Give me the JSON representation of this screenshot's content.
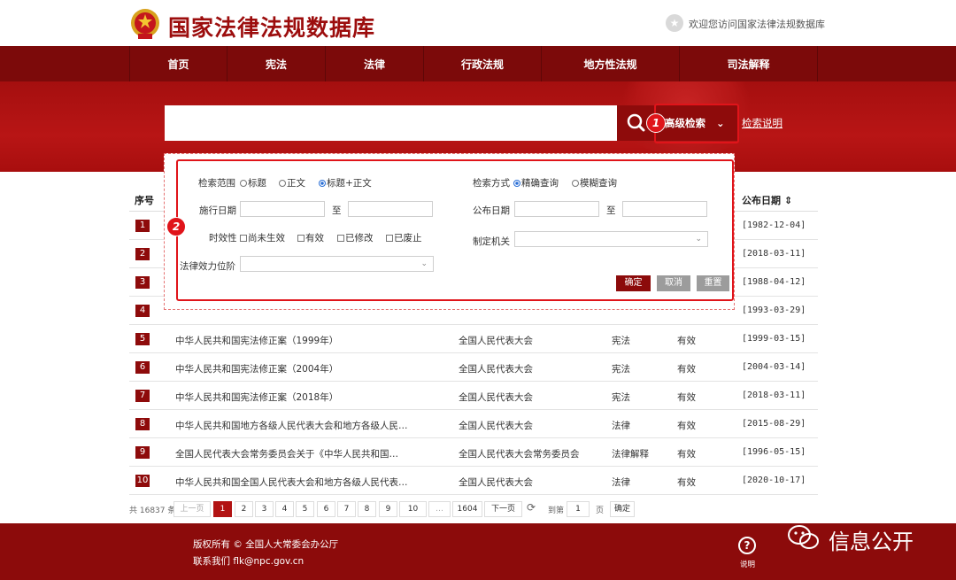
{
  "header": {
    "site_title": "国家法律法规数据库",
    "welcome": "欢迎您访问国家法律法规数据库"
  },
  "nav": [
    "首页",
    "宪法",
    "法律",
    "行政法规",
    "地方性法规",
    "司法解释"
  ],
  "search": {
    "placeholder": "",
    "advanced_label": "高级检索",
    "help_link": "检索说明"
  },
  "callouts": {
    "one": "1",
    "two": "2"
  },
  "advanced_panel": {
    "scope_label": "检索范围",
    "scope_options": [
      {
        "label": "标题",
        "selected": false
      },
      {
        "label": "正文",
        "selected": false
      },
      {
        "label": "标题+正文",
        "selected": true
      }
    ],
    "method_label": "检索方式",
    "method_options": [
      {
        "label": "精确查询",
        "selected": true
      },
      {
        "label": "模糊查询",
        "selected": false
      }
    ],
    "effective_date_label": "施行日期",
    "publish_date_label": "公布日期",
    "to": "至",
    "validity_label": "时效性",
    "validity_options": [
      "尚未生效",
      "有效",
      "已修改",
      "已废止"
    ],
    "authority_label": "制定机关",
    "level_label": "法律效力位阶",
    "confirm": "确定",
    "cancel": "取消",
    "reset": "重置"
  },
  "table": {
    "col_no": "序号",
    "col_date": "公布日期",
    "sort_icon": "sort-icon",
    "rows": [
      {
        "no": "1",
        "title": "",
        "org": "",
        "type": "",
        "status": "",
        "date": "[1982-12-04]"
      },
      {
        "no": "2",
        "title": "",
        "org": "",
        "type": "",
        "status": "",
        "date": "[2018-03-11]"
      },
      {
        "no": "3",
        "title": "",
        "org": "",
        "type": "",
        "status": "",
        "date": "[1988-04-12]"
      },
      {
        "no": "4",
        "title": "",
        "org": "",
        "type": "",
        "status": "",
        "date": "[1993-03-29]"
      },
      {
        "no": "5",
        "title": "中华人民共和国宪法修正案（1999年）",
        "org": "全国人民代表大会",
        "type": "宪法",
        "status": "有效",
        "date": "[1999-03-15]"
      },
      {
        "no": "6",
        "title": "中华人民共和国宪法修正案（2004年）",
        "org": "全国人民代表大会",
        "type": "宪法",
        "status": "有效",
        "date": "[2004-03-14]"
      },
      {
        "no": "7",
        "title": "中华人民共和国宪法修正案（2018年）",
        "org": "全国人民代表大会",
        "type": "宪法",
        "status": "有效",
        "date": "[2018-03-11]"
      },
      {
        "no": "8",
        "title": "中华人民共和国地方各级人民代表大会和地方各级人民…",
        "org": "全国人民代表大会",
        "type": "法律",
        "status": "有效",
        "date": "[2015-08-29]"
      },
      {
        "no": "9",
        "title": "全国人民代表大会常务委员会关于《中华人民共和国…",
        "org": "全国人民代表大会常务委员会",
        "type": "法律解释",
        "status": "有效",
        "date": "[1996-05-15]"
      },
      {
        "no": "10",
        "title": "中华人民共和国全国人民代表大会和地方各级人民代表…",
        "org": "全国人民代表大会",
        "type": "法律",
        "status": "有效",
        "date": "[2020-10-17]"
      }
    ]
  },
  "pagination": {
    "total": "共 16837 条",
    "prev": "上一页",
    "pages": [
      "1",
      "2",
      "3",
      "4",
      "5",
      "6",
      "7",
      "8",
      "9",
      "10"
    ],
    "ellipsis": "…",
    "last": "1604",
    "next": "下一页",
    "goto_label": "到第",
    "goto_value": "1",
    "page_unit": "页",
    "confirm": "确定"
  },
  "footer": {
    "copyright": "版权所有 © 全国人大常委会办公厅",
    "contact": "联系我们 flk@npc.gov.cn",
    "help_label": "说明",
    "help_glyph": "?",
    "watermark": "信息公开"
  }
}
